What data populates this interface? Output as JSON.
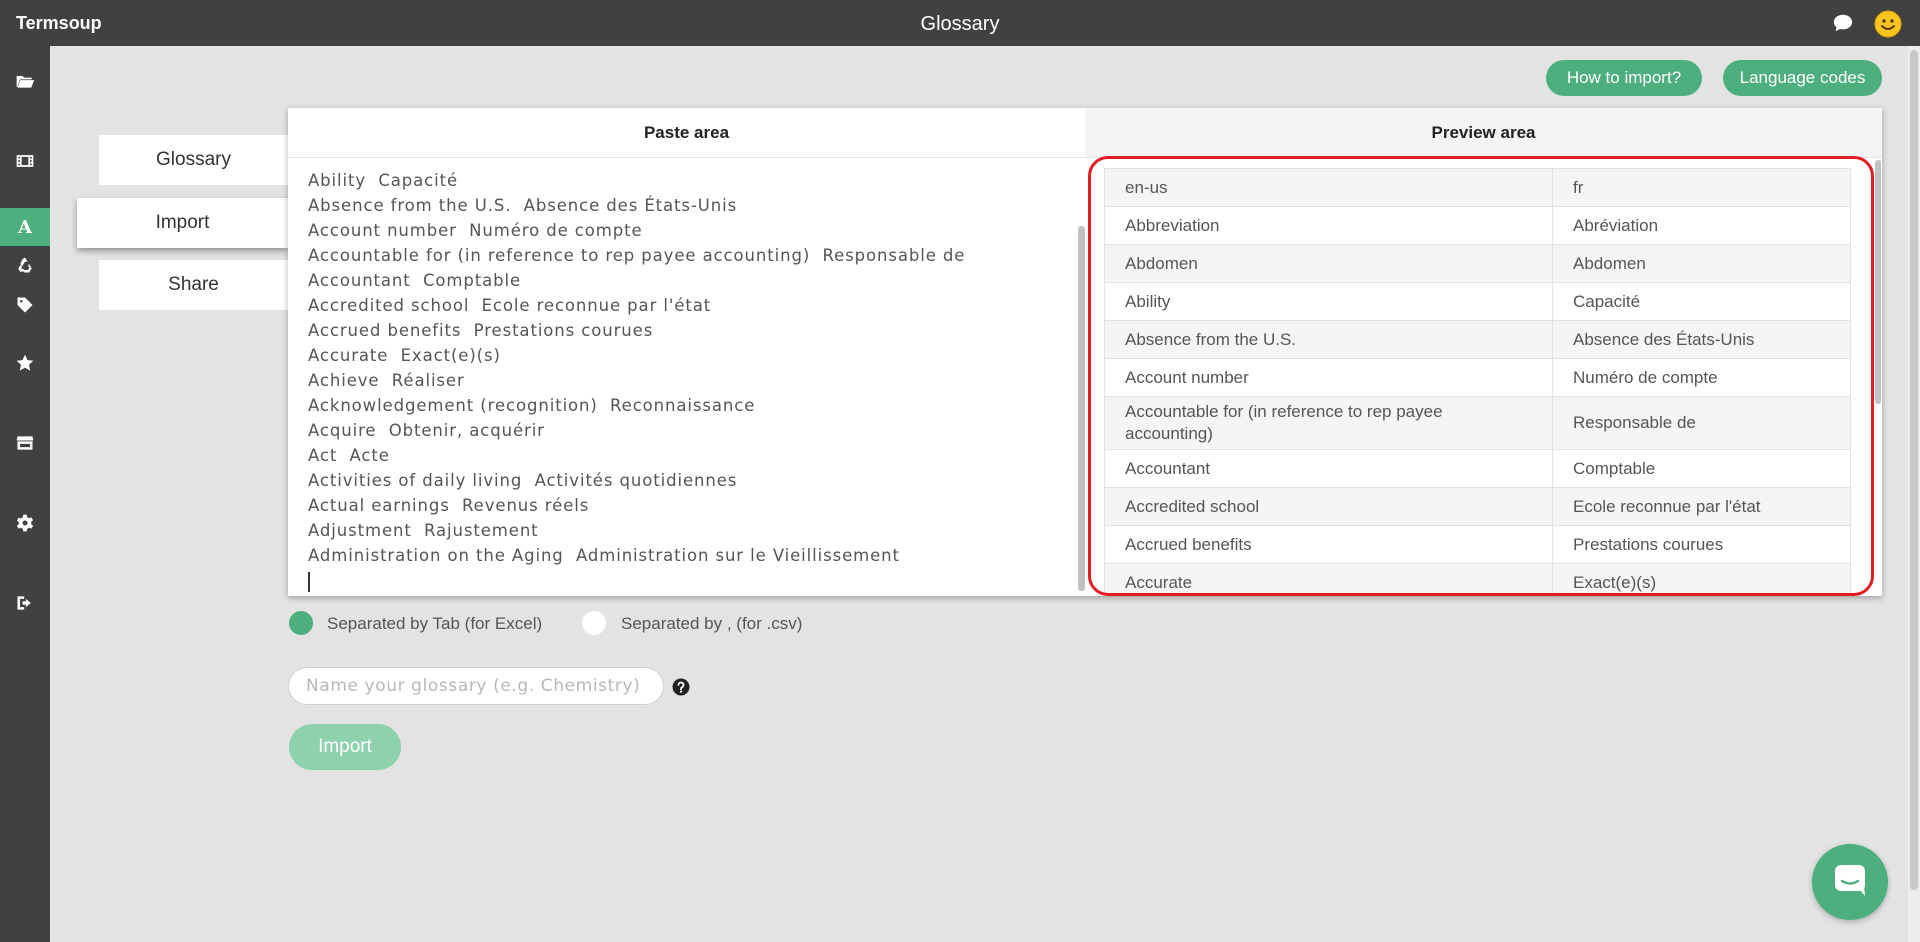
{
  "app": {
    "brand": "Termsoup",
    "title": "Glossary"
  },
  "topbar": {
    "icons": [
      "chat-icon",
      "smiley-avatar-icon"
    ]
  },
  "sidebar": {
    "items": [
      {
        "icon": "folder-open-icon"
      },
      {
        "icon": "film-icon"
      },
      {
        "icon": "glossary-a-icon",
        "label": "A",
        "active": true
      },
      {
        "icon": "recycle-icon"
      },
      {
        "icon": "tag-icon"
      },
      {
        "icon": "star-icon"
      },
      {
        "icon": "store-icon"
      },
      {
        "icon": "gear-icon"
      },
      {
        "icon": "sign-out-icon"
      }
    ]
  },
  "toolbar": {
    "how_to_import": "How to import?",
    "language_codes": "Language codes"
  },
  "tabs": [
    {
      "label": "Glossary"
    },
    {
      "label": "Import",
      "active": true
    },
    {
      "label": "Share"
    }
  ],
  "paste_area": {
    "header": "Paste area",
    "lines": [
      "Ability\tCapacité",
      "Absence from the U.S.\tAbsence des États-Unis",
      "Account number\tNuméro de compte",
      "Accountable for (in reference to rep payee accounting)\tResponsable de",
      "Accountant\tComptable",
      "Accredited school\tEcole reconnue par l'état",
      "Accrued benefits\tPrestations courues",
      "Accurate\tExact(e)(s)",
      "Achieve\tRéaliser",
      "Acknowledgement (recognition)\tReconnaissance",
      "Acquire\tObtenir, acquérir",
      "Act\tActe",
      "Activities of daily living\tActivités quotidiennes",
      "Actual earnings\tRevenus réels",
      "Adjustment\tRajustement",
      "Administration on the Aging\tAdministration sur le Vieillissement",
      ""
    ]
  },
  "preview_area": {
    "header": "Preview area",
    "rows": [
      [
        "en-us",
        "fr"
      ],
      [
        "Abbreviation",
        "Abréviation"
      ],
      [
        "Abdomen",
        "Abdomen"
      ],
      [
        "Ability",
        "Capacité"
      ],
      [
        "Absence from the U.S.",
        "Absence des États-Unis"
      ],
      [
        "Account number",
        "Numéro de compte"
      ],
      [
        "Accountable for (in reference to rep payee accounting)",
        "Responsable de"
      ],
      [
        "Accountant",
        "Comptable"
      ],
      [
        "Accredited school",
        "Ecole reconnue par l'état"
      ],
      [
        "Accrued benefits",
        "Prestations courues"
      ],
      [
        "Accurate",
        "Exact(e)(s)"
      ]
    ]
  },
  "separator": {
    "tab_label": "Separated by Tab (for Excel)",
    "comma_label": "Separated by , (for .csv)",
    "selected": "tab"
  },
  "glossary_name": {
    "placeholder": "Name your glossary (e.g. Chemistry)",
    "value": ""
  },
  "import_button": "Import",
  "colors": {
    "accent": "#4caf7d",
    "topbar": "#414141",
    "highlight": "#e21c23"
  }
}
